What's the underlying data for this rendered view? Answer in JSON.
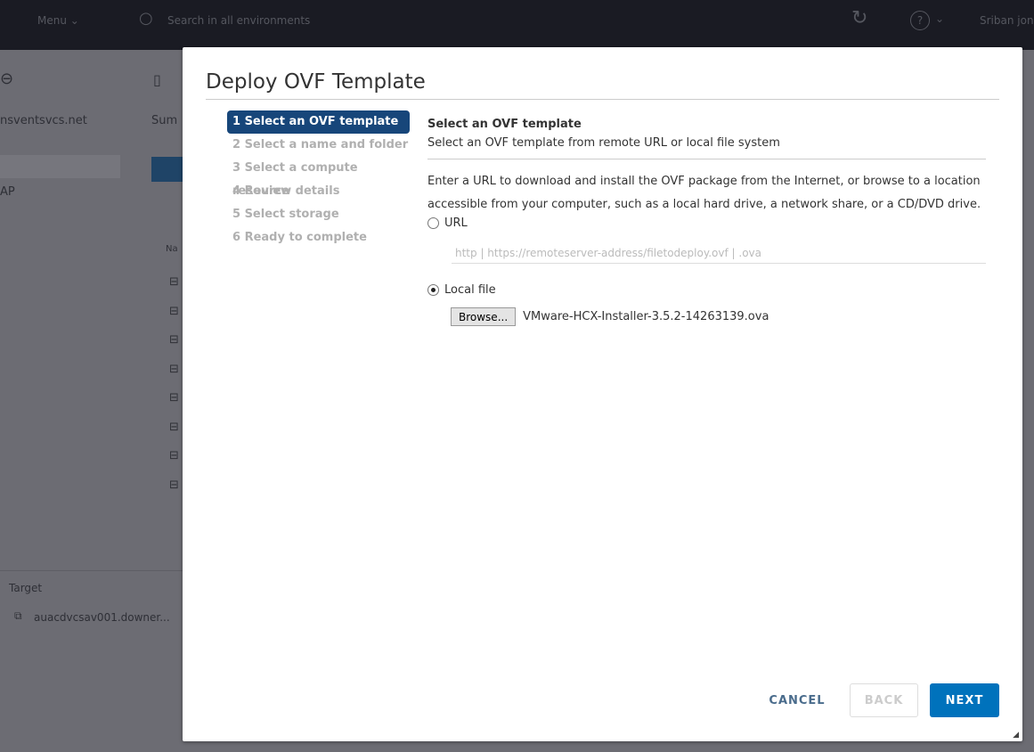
{
  "topbar": {
    "menu": "Menu",
    "search_placeholder": "Search in all environments",
    "user": "Sriban jon"
  },
  "background": {
    "host": "nsventsvcs.net",
    "summary_tab": "Sum",
    "tree_item": "AP",
    "name_col": "Na",
    "tasks": {
      "target_header": "Target",
      "target_value": "auacdvcsav001.downer..."
    }
  },
  "dialog": {
    "title": "Deploy OVF Template",
    "steps": [
      {
        "label": "1 Select an OVF template",
        "active": true
      },
      {
        "label": "2 Select a name and folder",
        "active": false
      },
      {
        "label": "3 Select a compute resource",
        "active": false
      },
      {
        "label": "4 Review details",
        "active": false
      },
      {
        "label": "5 Select storage",
        "active": false
      },
      {
        "label": "6 Ready to complete",
        "active": false
      }
    ],
    "heading": "Select an OVF template",
    "subheading": "Select an OVF template from remote URL or local file system",
    "description": "Enter a URL to download and install the OVF package from the Internet, or browse to a location accessible from your computer, such as a local hard drive, a network share, or a CD/DVD drive.",
    "url_option": {
      "label": "URL",
      "selected": false,
      "placeholder": "http | https://remoteserver-address/filetodeploy.ovf | .ova"
    },
    "local_option": {
      "label": "Local file",
      "selected": true
    },
    "browse_label": "Browse...",
    "file_name": "VMware-HCX-Installer-3.5.2-14263139.ova",
    "buttons": {
      "cancel": "CANCEL",
      "back": "BACK",
      "next": "NEXT"
    },
    "colors": {
      "accent": "#0072bc",
      "active_step": "#17467a"
    }
  }
}
